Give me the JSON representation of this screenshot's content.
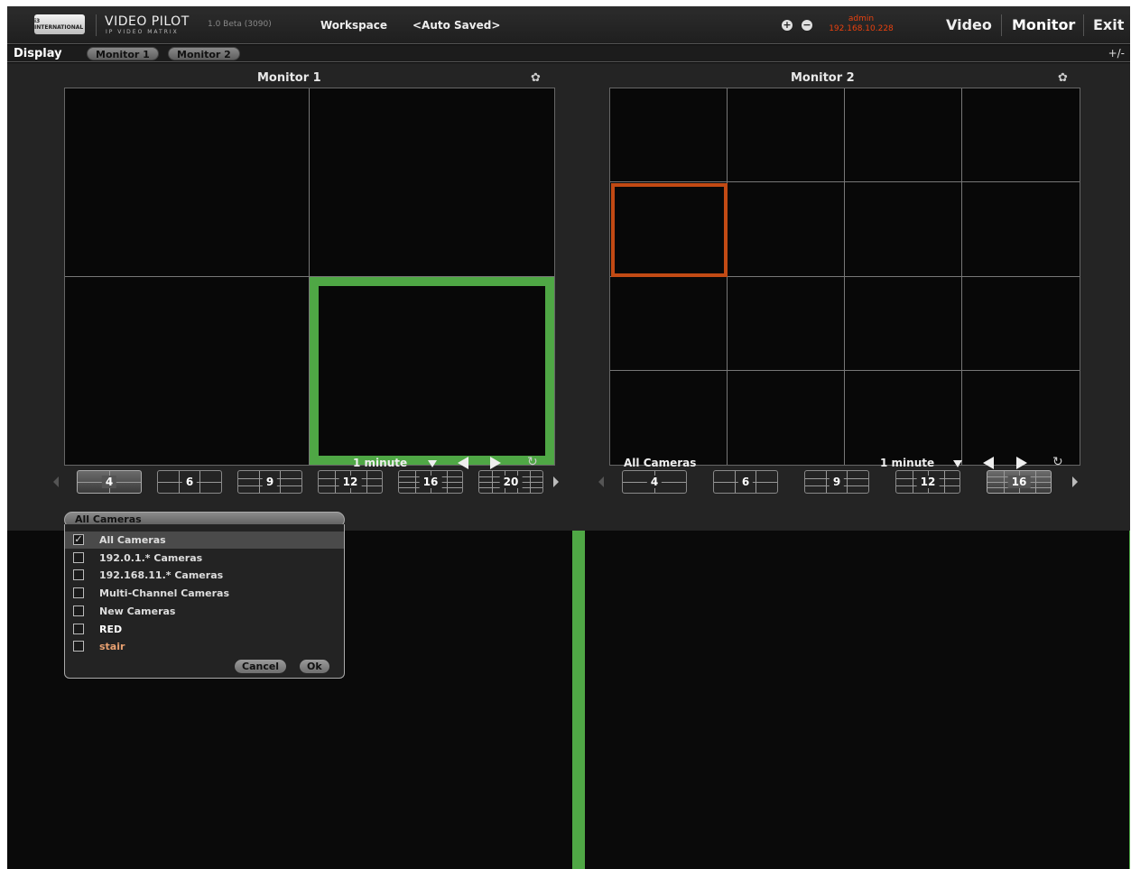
{
  "header": {
    "logo_text": "i3 INTERNATIONAL",
    "app_name": "VIDEO PILOT",
    "app_sub": "IP VIDEO MATRIX",
    "version": "1.0 Beta (3090)",
    "workspace_label": "Workspace",
    "workspace_status": "<Auto Saved>",
    "add_icon": "plus-circle-icon",
    "remove_icon": "minus-circle-icon",
    "user_name": "admin",
    "user_ip": "192.168.10.228",
    "nav": [
      "Video",
      "Monitor",
      "Exit"
    ],
    "active_nav": "Monitor",
    "user_color": "#e8410f"
  },
  "display_bar": {
    "label": "Display",
    "tabs": [
      "Monitor 1",
      "Monitor 2"
    ],
    "toggle": "+/-"
  },
  "monitors": [
    {
      "title": "Monitor 1",
      "grid_columns": 2,
      "grid_rows": 2,
      "selected_cell": 3,
      "selection_color": "#4fa745",
      "layouts": [
        "4",
        "6",
        "9",
        "12",
        "16",
        "20"
      ],
      "active_layout": "4",
      "camera_filter": "All Cameras",
      "interval": "1 minute"
    },
    {
      "title": "Monitor 2",
      "grid_columns": 4,
      "grid_rows": 4,
      "selected_cell": 4,
      "selection_color": "#c24a14",
      "layouts": [
        "4",
        "6",
        "9",
        "12",
        "16"
      ],
      "active_layout": "16",
      "camera_filter": "All Cameras",
      "interval": "1 minute"
    }
  ],
  "camera_dropdown": {
    "items": [
      {
        "label": "All Cameras",
        "checked": true,
        "color": "#dddddd"
      },
      {
        "label": "192.0.1.* Cameras",
        "checked": false,
        "color": "#dddddd"
      },
      {
        "label": "192.168.11.* Cameras",
        "checked": false,
        "color": "#dddddd"
      },
      {
        "label": "Multi-Channel Cameras",
        "checked": false,
        "color": "#dddddd"
      },
      {
        "label": "New Cameras",
        "checked": false,
        "color": "#dddddd"
      },
      {
        "label": "RED",
        "checked": false,
        "color": "#ffffff"
      },
      {
        "label": "stair",
        "checked": false,
        "color": "#e8a070"
      }
    ],
    "cancel_label": "Cancel",
    "ok_label": "Ok"
  }
}
